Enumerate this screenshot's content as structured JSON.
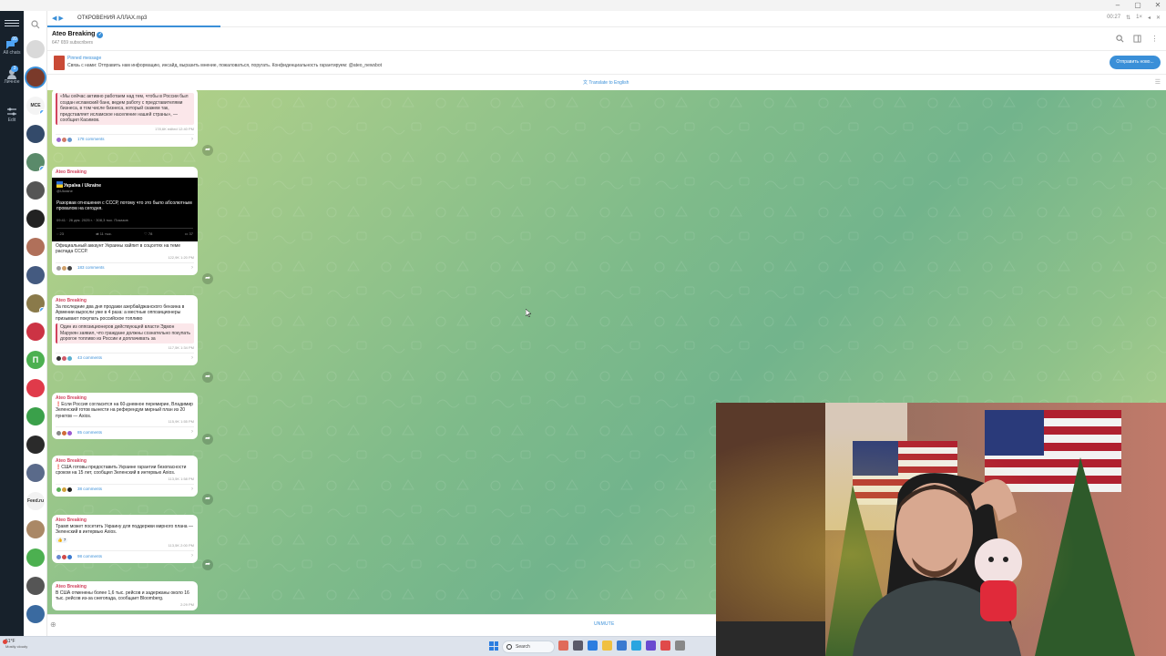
{
  "app": {
    "tab_file": "ОТКРОВЕНИЯ АЛЛАХ.mp3",
    "tab_time": "00:27"
  },
  "rail": {
    "items": [
      {
        "label": "All chats",
        "badge": "99"
      },
      {
        "label": "Личное",
        "badge": "3"
      },
      {
        "label": "Edit",
        "badge": ""
      }
    ]
  },
  "chatlist": {
    "avatars": [
      {
        "letter": "",
        "color": "#d9d9d9"
      },
      {
        "letter": "",
        "color": "#7a3a2a"
      },
      {
        "letter": "МСЕ",
        "color": "#f4f4f4"
      },
      {
        "letter": "",
        "color": "#334a6a"
      },
      {
        "letter": "",
        "color": "#5a8a6a"
      },
      {
        "letter": "",
        "color": "#555555"
      },
      {
        "letter": "",
        "color": "#222222"
      },
      {
        "letter": "",
        "color": "#b0705a"
      },
      {
        "letter": "",
        "color": "#445a80"
      },
      {
        "letter": "",
        "color": "#8a7a4a"
      },
      {
        "letter": "",
        "color": "#cc3344"
      },
      {
        "letter": "П",
        "color": "#4cb050"
      },
      {
        "letter": "",
        "color": "#e03a4a"
      },
      {
        "letter": "",
        "color": "#3aa04a"
      },
      {
        "letter": "",
        "color": "#2a2a2a"
      },
      {
        "letter": "",
        "color": "#5a6a8a"
      },
      {
        "letter": "Feed.ru",
        "color": "#f2f2f2"
      },
      {
        "letter": "",
        "color": "#aa8866"
      },
      {
        "letter": "",
        "color": "#4cb050"
      },
      {
        "letter": "",
        "color": "#555555"
      },
      {
        "letter": "",
        "color": "#3a6aa0"
      }
    ]
  },
  "channel": {
    "title": "Ateo Breaking",
    "subscribers": "647 659 subscribers"
  },
  "pinned": {
    "label": "Pinned message",
    "text": "Связь с нами:  Отправить нам информацию, инсайд, выразить мнение, пожаловаться, поругать. Конфиденциальность гарантируем: @ateo_newsbot",
    "button": "Отправить ново..."
  },
  "translate": {
    "label": "Translate to English"
  },
  "messages": [
    {
      "quote": "«Мы сейчас активно работаем над тем, чтобы в России был создан исламский банк, ведем работу с представителями бизнеса, в том числе бизнеса, который скажем так, представляет исламское население нашей страны», — сообщил Касимов.",
      "meta": "178,6K  edited 12:40 PM",
      "comments": "178 comments"
    },
    {
      "author": "Ateo Breaking",
      "tweet_name": "Україна / Ukraine",
      "tweet_handle": "@Ukraine",
      "tweet_text": "Разорвав отношения с СССР, потому что это было абсолютным провалом на сегодня.",
      "tweet_date": "09:41 · 26 дек. 2025 г. · 308,3 тыс. Показов",
      "tweet_stats": [
        "23",
        "11 тыс.",
        "78",
        "37"
      ],
      "text": "Официальный аккаунт Украины хайпит в соцсетях на теме распада СССР.",
      "meta": "122,9K  1:20 PM",
      "comments": "183 comments"
    },
    {
      "author": "Ateo Breaking",
      "text": "За последние два дня продажи азербайджанского бензина в Армении выросли уже в 4 раза: а местные оппозиционеры призывают покупать российское топливо",
      "quote": "Один из оппозиционеров действующей власти Эдмон Марукян заявил, что граждане должны сознательно покупать дорогое топливо из России и доплачивать за",
      "meta": "117,5K  1:34 PM",
      "comments": "43 comments"
    },
    {
      "author": "Ateo Breaking",
      "text": "❗️Если Россия согласится на 60-дневное перемирие, Владимир Зеленский готов вынести на референдум мирный план из 20 пунктов — Axios.",
      "meta": "115,9K  1:55 PM",
      "comments": "85 comments"
    },
    {
      "author": "Ateo Breaking",
      "text": "❗️США готовы предоставить Украине гарантии безопасности сроком на 15 лет, сообщил Зеленский в интервью Axios.",
      "meta": "113,5K  1:58 PM",
      "comments": "38 comments"
    },
    {
      "author": "Ateo Breaking",
      "text": "Трамп может посетить Украину для поддержки мирного плана — Зеленский в интервью Axios.",
      "reaction": "👍 7",
      "meta": "113,5K  2:00 PM",
      "comments": "98 comments"
    },
    {
      "author": "Ateo Breaking",
      "text": "В США отменены более 1,6 тыс. рейсов и задержаны около 16 тыс. рейсов из-за снегопада, сообщает Bloomberg.",
      "meta": "2:29 PM"
    }
  ],
  "input": {
    "unmute": "UNMUTE"
  },
  "taskbar": {
    "temp": "51°F",
    "weather": "Mostly cloudy",
    "search": "Search"
  },
  "colors": {
    "accent": "#3a8fd8",
    "author": "#d1445e",
    "rail": "#17212b"
  }
}
